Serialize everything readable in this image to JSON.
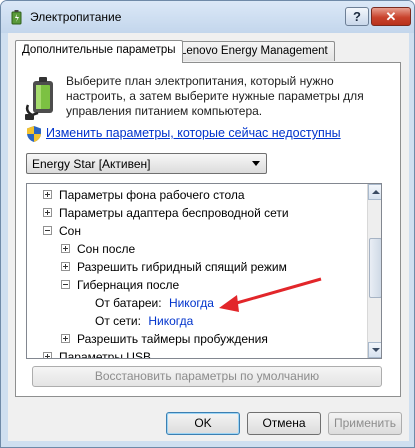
{
  "window": {
    "title": "Электропитание"
  },
  "titlebar": {
    "help_label": "?",
    "close_label": "✕"
  },
  "tabs": [
    {
      "label": "Дополнительные параметры",
      "active": true
    },
    {
      "label": "Lenovo Energy Management",
      "active": false
    }
  ],
  "panel": {
    "description": "Выберите план электропитания, который нужно настроить, а затем выберите нужные параметры для управления питанием компьютера.",
    "change_link": "Изменить параметры, которые сейчас недоступны",
    "plan_selected": "Energy Star [Активен]"
  },
  "tree": [
    {
      "label": "Параметры фона рабочего стола",
      "level": 0,
      "state": "collapsed"
    },
    {
      "label": "Параметры адаптера беспроводной сети",
      "level": 0,
      "state": "collapsed"
    },
    {
      "label": "Сон",
      "level": 0,
      "state": "expanded"
    },
    {
      "label": "Сон после",
      "level": 1,
      "state": "collapsed"
    },
    {
      "label": "Разрешить гибридный спящий режим",
      "level": 1,
      "state": "collapsed"
    },
    {
      "label": "Гибернация после",
      "level": 1,
      "state": "expanded"
    },
    {
      "label": "От батареи:",
      "value": "Никогда",
      "level": 2,
      "state": "leaf"
    },
    {
      "label": "От сети:",
      "value": "Никогда",
      "level": 2,
      "state": "leaf"
    },
    {
      "label": "Разрешить таймеры пробуждения",
      "level": 1,
      "state": "collapsed"
    },
    {
      "label": "Параметры USB",
      "level": 0,
      "state": "collapsed"
    }
  ],
  "buttons": {
    "restore_defaults": "Восстановить параметры по умолчанию",
    "ok": "OK",
    "cancel": "Отмена",
    "apply": "Применить"
  },
  "colors": {
    "link": "#0033cc",
    "annotation_arrow": "#e2262a"
  }
}
